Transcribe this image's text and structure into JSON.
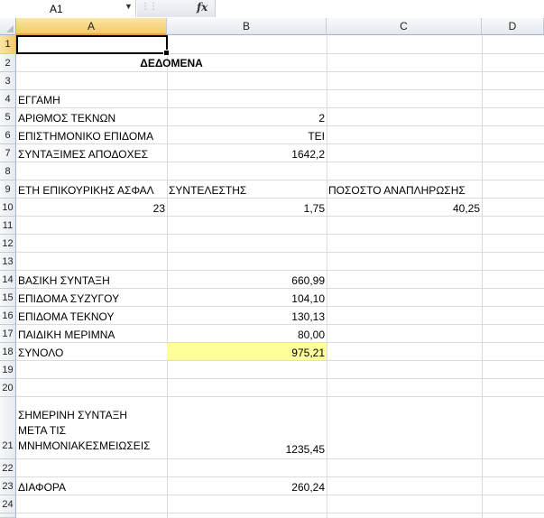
{
  "formula_bar": {
    "name_box": "A1",
    "dropdown_icon": "chevron-down-icon",
    "fx_label": "fx",
    "formula": ""
  },
  "columns": [
    "A",
    "B",
    "C",
    "D"
  ],
  "rows": [
    "1",
    "2",
    "3",
    "4",
    "5",
    "6",
    "7",
    "8",
    "9",
    "10",
    "11",
    "12",
    "13",
    "14",
    "15",
    "16",
    "17",
    "18",
    "19",
    "20",
    "21",
    "22",
    "23",
    "24"
  ],
  "colors": {
    "selected_header": "#f5c966",
    "highlight_fill": "#ffff99",
    "gridline": "#dadcdd"
  },
  "cells": {
    "A2_B2": "ΔΕΔΟΜΕΝΑ",
    "A4": "ΕΓΓΑΜΗ",
    "A5": "ΑΡΙΘΜΟΣ ΤΕΚΝΩΝ",
    "B5": "2",
    "A6": "ΕΠΙΣΤΗΜΟΝΙΚΟ ΕΠΙΔΟΜΑ",
    "B6": "ΤΕΙ",
    "A7": "ΣΥΝΤΑΞΙΜΕΣ ΑΠΟΔΟΧΕΣ",
    "B7": "1642,2",
    "A9": "ΕΤΗ ΕΠΙΚΟΥΡΙΚΗΣ ΑΣΦΑΛ",
    "B9": "ΣΥΝΤΕΛΕΣΤΗΣ",
    "C9": "ΠΟΣΟΣΤΟ ΑΝΑΠΛΗΡΩΣΗΣ",
    "A10": "23",
    "B10": "1,75",
    "C10": "40,25",
    "A14": "ΒΑΣΙΚΗ ΣΥΝΤΑΞΗ",
    "B14": "660,99",
    "A15": "ΕΠΙΔΟΜΑ ΣΥΖΥΓΟΥ",
    "B15": "104,10",
    "A16": "ΕΠΙΔΟΜΑ ΤΕΚΝΟΥ",
    "B16": "130,13",
    "A17": "ΠΑΙΔΙΚΗ ΜΕΡΙΜΝΑ",
    "B17": "80,00",
    "A18": "ΣΥΝΟΛΟ",
    "B18": "975,21",
    "A21_line1": "ΣΗΜΕΡΙΝΗ ΣΥΝΤΑΞΗ",
    "A21_line2": "ΜΕΤΑ ΤΙΣ",
    "A21_line3": "ΜΝΗΜΟΝΙΑΚΕΣΜΕΙΩΣΕΙΣ",
    "B21": "1235,45",
    "A23": "ΔΙΑΦΟΡΑ",
    "B23": "260,24"
  }
}
